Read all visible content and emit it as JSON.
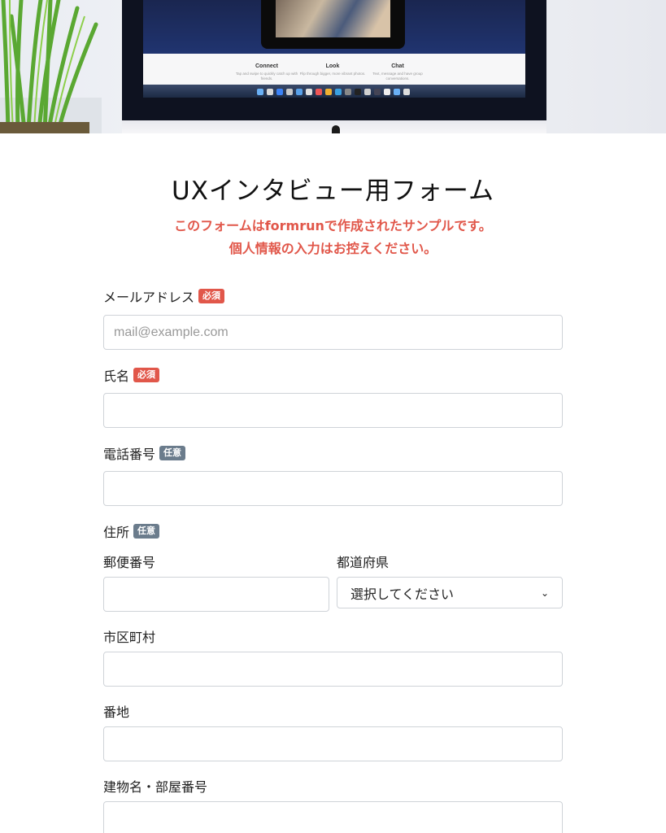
{
  "hero": {
    "features": [
      {
        "title": "Connect",
        "desc": "Tap and swipe to quickly catch up with friends."
      },
      {
        "title": "Look",
        "desc": "Flip through bigger, more vibrant photos."
      },
      {
        "title": "Chat",
        "desc": "Text, message and have group conversations."
      }
    ]
  },
  "form": {
    "title": "UXインタビュー用フォーム",
    "notice_line1": "このフォームはformrunで作成されたサンプルです。",
    "notice_line2": "個人情報の入力はお控えください。",
    "badge_required": "必須",
    "badge_optional": "任意",
    "fields": {
      "email": {
        "label": "メールアドレス",
        "placeholder": "mail@example.com"
      },
      "name": {
        "label": "氏名"
      },
      "phone": {
        "label": "電話番号"
      },
      "address": {
        "label": "住所"
      },
      "postal": {
        "label": "郵便番号"
      },
      "prefecture": {
        "label": "都道府県",
        "selected": "選択してください"
      },
      "city": {
        "label": "市区町村"
      },
      "street": {
        "label": "番地"
      },
      "building": {
        "label": "建物名・部屋番号"
      }
    }
  },
  "colors": {
    "required": "#e1574a",
    "optional": "#6b7c8c",
    "notice": "#e1574a"
  }
}
